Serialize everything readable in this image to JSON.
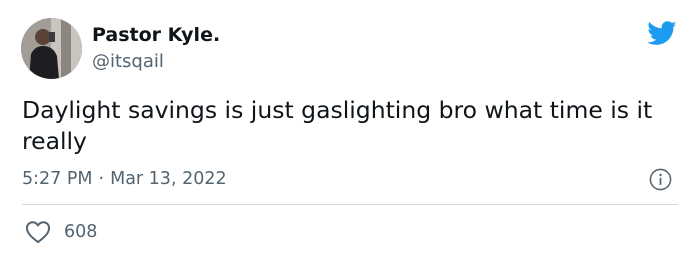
{
  "author": {
    "name": "Pastor Kyle.",
    "handle": "@itsqail",
    "avatar_icon": "profile-photo"
  },
  "tweet": {
    "text": "Daylight savings is just gaslighting bro what time is it really",
    "time": "5:27 PM",
    "separator": "·",
    "date": "Mar 13, 2022"
  },
  "actions": {
    "like_icon": "heart-outline-icon",
    "like_count": "608"
  },
  "colors": {
    "brand": "#1d9bf0",
    "text_primary": "#0f1419",
    "text_secondary": "#536471",
    "divider": "#cfd9de"
  }
}
